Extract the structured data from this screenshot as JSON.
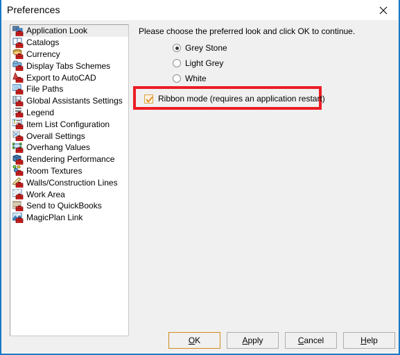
{
  "window": {
    "title": "Preferences",
    "close_icon": "close-icon",
    "accent_border": "#1b79c4",
    "body_background": "#f0f0f0"
  },
  "sidebar": {
    "selected_index": 0,
    "items": [
      {
        "label": "Application Look",
        "icon": "application-look-icon"
      },
      {
        "label": "Catalogs",
        "icon": "catalogs-icon"
      },
      {
        "label": "Currency",
        "icon": "currency-icon"
      },
      {
        "label": "Display Tabs Schemes",
        "icon": "display-tabs-schemes-icon"
      },
      {
        "label": "Export to AutoCAD",
        "icon": "export-to-autocad-icon"
      },
      {
        "label": "File Paths",
        "icon": "file-paths-icon"
      },
      {
        "label": "Global Assistants Settings",
        "icon": "global-assistants-settings-icon"
      },
      {
        "label": "Legend",
        "icon": "legend-icon"
      },
      {
        "label": "Item List Configuration",
        "icon": "item-list-configuration-icon"
      },
      {
        "label": "Overall Settings",
        "icon": "overall-settings-icon"
      },
      {
        "label": "Overhang Values",
        "icon": "overhang-values-icon"
      },
      {
        "label": "Rendering Performance",
        "icon": "rendering-performance-icon"
      },
      {
        "label": "Room Textures",
        "icon": "room-textures-icon"
      },
      {
        "label": "Walls/Construction Lines",
        "icon": "walls-construction-lines-icon"
      },
      {
        "label": "Work Area",
        "icon": "work-area-icon"
      },
      {
        "label": "Send to QuickBooks",
        "icon": "send-to-quickbooks-icon"
      },
      {
        "label": "MagicPlan Link",
        "icon": "magicplan-link-icon"
      }
    ]
  },
  "main": {
    "instruction": "Please choose the preferred look and click OK to continue.",
    "look_options": [
      {
        "label": "Grey Stone",
        "selected": true
      },
      {
        "label": "Light Grey",
        "selected": false
      },
      {
        "label": "White",
        "selected": false
      }
    ],
    "ribbon_mode": {
      "label": "Ribbon mode (requires an application restart)",
      "checked": true,
      "highlight_color": "#ed1c24",
      "check_color": "#e08a1e"
    }
  },
  "footer": {
    "buttons": [
      {
        "id": "ok",
        "prefix": "",
        "mnemonic": "O",
        "suffix": "K",
        "default": true
      },
      {
        "id": "apply",
        "prefix": "",
        "mnemonic": "A",
        "suffix": "pply",
        "default": false
      },
      {
        "id": "cancel",
        "prefix": "",
        "mnemonic": "C",
        "suffix": "ancel",
        "default": false
      },
      {
        "id": "help",
        "prefix": "",
        "mnemonic": "H",
        "suffix": "elp",
        "default": false
      }
    ]
  }
}
